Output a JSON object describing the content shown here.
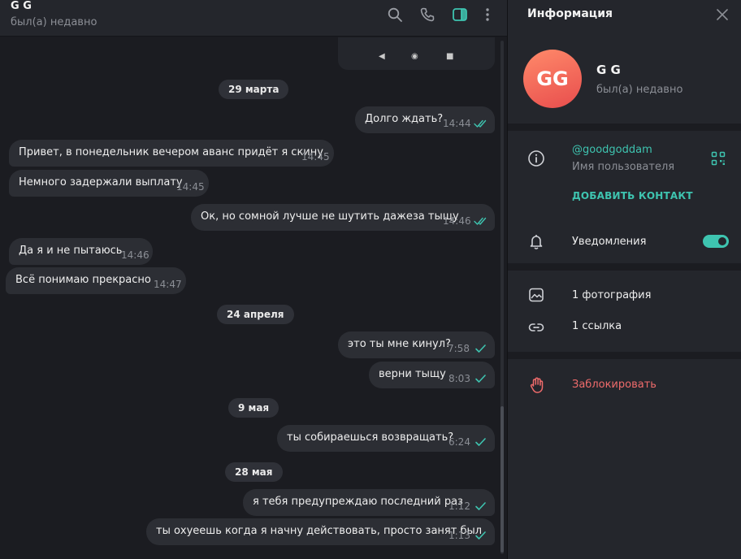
{
  "chat": {
    "title": "G G",
    "status": "был(а) недавно",
    "nav_glyphs": [
      "◀",
      "◉",
      "■"
    ],
    "messages": [
      {
        "kind": "date",
        "text": "29 марта"
      },
      {
        "kind": "out",
        "text": "Долго ждать?",
        "time": "14:44",
        "read": true
      },
      {
        "kind": "in",
        "text": "Привет, в понедельник вечером аванс придёт я скину",
        "time": "14:45"
      },
      {
        "kind": "in",
        "text": "Немного задержали выплату",
        "time": "14:45"
      },
      {
        "kind": "out",
        "text": "Ок, но сомной лучше не шутить дажеза тыщу",
        "time": "14:46",
        "read": true
      },
      {
        "kind": "in",
        "text": "Да я и не пытаюсь",
        "time": "14:46"
      },
      {
        "kind": "in",
        "text": "Всё понимаю прекрасно",
        "time": "14:47"
      },
      {
        "kind": "date",
        "text": "24 апреля"
      },
      {
        "kind": "out",
        "text": "это ты мне кинул?",
        "time": "7:58",
        "read": false
      },
      {
        "kind": "out",
        "text": "верни тыщу",
        "time": "8:03",
        "read": false
      },
      {
        "kind": "date",
        "text": "9 мая"
      },
      {
        "kind": "out",
        "text": "ты собираешься возвращать?",
        "time": "6:24",
        "read": false
      },
      {
        "kind": "date",
        "text": "28 мая"
      },
      {
        "kind": "out",
        "text": "я тебя предупреждаю последний раз",
        "time": "1:12",
        "read": false
      },
      {
        "kind": "out",
        "text": "ты охуеешь когда я начну действовать, просто занят был",
        "time": "1:13",
        "read": false
      }
    ]
  },
  "info": {
    "title": "Информация",
    "avatar_initials": "GG",
    "name": "G G",
    "status": "был(а) недавно",
    "username": "@goodgoddam",
    "username_caption": "Имя пользователя",
    "add_contact": "ДОБАВИТЬ КОНТАКТ",
    "notifications": "Уведомления",
    "notifications_on": true,
    "photos": "1 фотография",
    "links": "1 ссылка",
    "block": "Заблокировать"
  },
  "icons": {
    "search": "search-icon",
    "call": "phone-icon",
    "sidebar": "sidebar-toggle-icon",
    "more": "more-vertical-icon",
    "close": "close-icon",
    "info": "info-icon",
    "qr": "qr-code-icon",
    "bell": "bell-icon",
    "photo": "photo-icon",
    "link": "link-icon",
    "hand": "hand-stop-icon"
  },
  "colors": {
    "accent": "#3ec4b0",
    "danger": "#ef6b6b",
    "avatar_from": "#ff8a6a",
    "avatar_to": "#e84d4d"
  }
}
